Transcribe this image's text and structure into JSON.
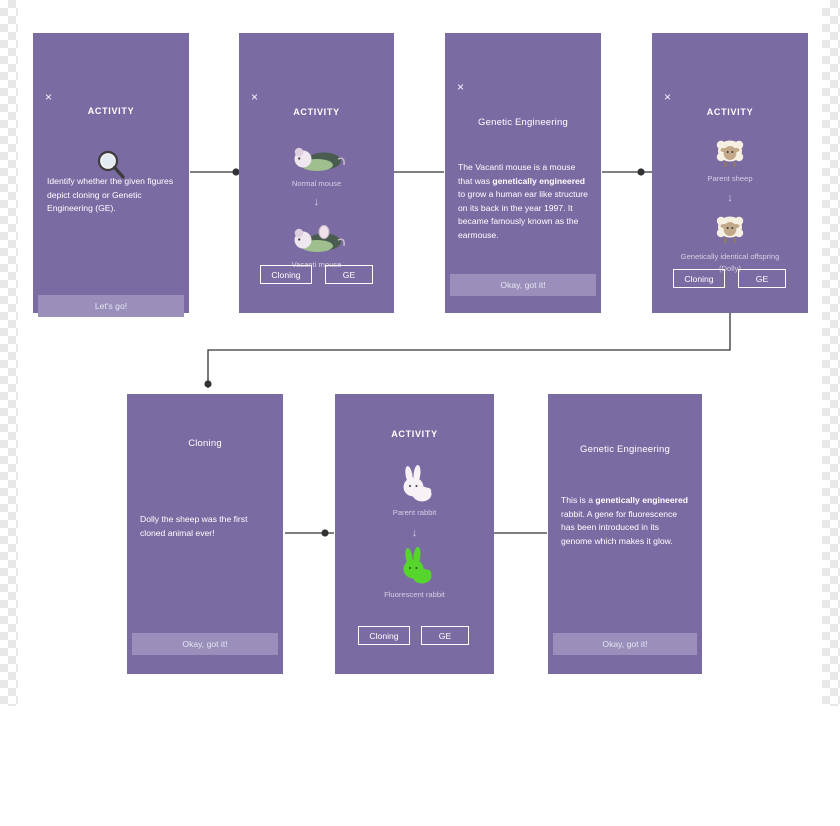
{
  "meta": {
    "accent": "#7a6ba3",
    "button_fill": "#9a8fba",
    "caption_color": "#d6d0e4",
    "connector_color": "#333333"
  },
  "cards": [
    {
      "id": "card-intro",
      "close": "×",
      "title": "ACTIVITY",
      "icon": "magnifier-icon",
      "body": "Identify whether the given figures depict cloning or Genetic Engineering (GE).",
      "primary_button": "Let's go!"
    },
    {
      "id": "card-mouse",
      "close": "×",
      "title": "ACTIVITY",
      "icon_top": "normal-mouse-icon",
      "caption_top": "Normal mouse",
      "arrow": "↓",
      "icon_bottom": "vacanti-mouse-icon",
      "caption_bottom": "Vacanti mouse",
      "choice_left": "Cloning",
      "choice_right": "GE"
    },
    {
      "id": "card-mouse-answer",
      "close": "×",
      "title": "Genetic Engineering",
      "body_parts": [
        {
          "text": "The Vacanti mouse is a mouse that was ",
          "bold": false
        },
        {
          "text": "genetically engineered",
          "bold": true
        },
        {
          "text": " to grow a human ear like structure on its back in the year 1997. It became famously known as the earmouse.",
          "bold": false
        }
      ],
      "primary_button": "Okay, got it!"
    },
    {
      "id": "card-sheep",
      "close": "×",
      "title": "ACTIVITY",
      "icon_top": "parent-sheep-icon",
      "caption_top": "Parent sheep",
      "arrow": "↓",
      "icon_bottom": "clone-sheep-icon",
      "caption_bottom": "Genetically identical offspring (Dolly)",
      "choice_left": "Cloning",
      "choice_right": "GE"
    },
    {
      "id": "card-sheep-answer",
      "close": "×",
      "title": "Cloning",
      "body": "Dolly the sheep was the first cloned animal ever!",
      "primary_button": "Okay, got it!"
    },
    {
      "id": "card-rabbit",
      "close": "×",
      "title": "ACTIVITY",
      "icon_top": "parent-rabbit-icon",
      "caption_top": "Parent rabbit",
      "arrow": "↓",
      "icon_bottom": "fluorescent-rabbit-icon",
      "caption_bottom": "Fluorescent rabbit",
      "choice_left": "Cloning",
      "choice_right": "GE"
    },
    {
      "id": "card-rabbit-answer",
      "close": "×",
      "title": "Genetic Engineering",
      "body_parts": [
        {
          "text": "This is a ",
          "bold": false
        },
        {
          "text": "genetically engineered",
          "bold": true
        },
        {
          "text": " rabbit. A gene for fluorescence has been introduced in its genome which makes it glow.",
          "bold": false
        }
      ],
      "primary_button": "Okay, got it!"
    }
  ]
}
